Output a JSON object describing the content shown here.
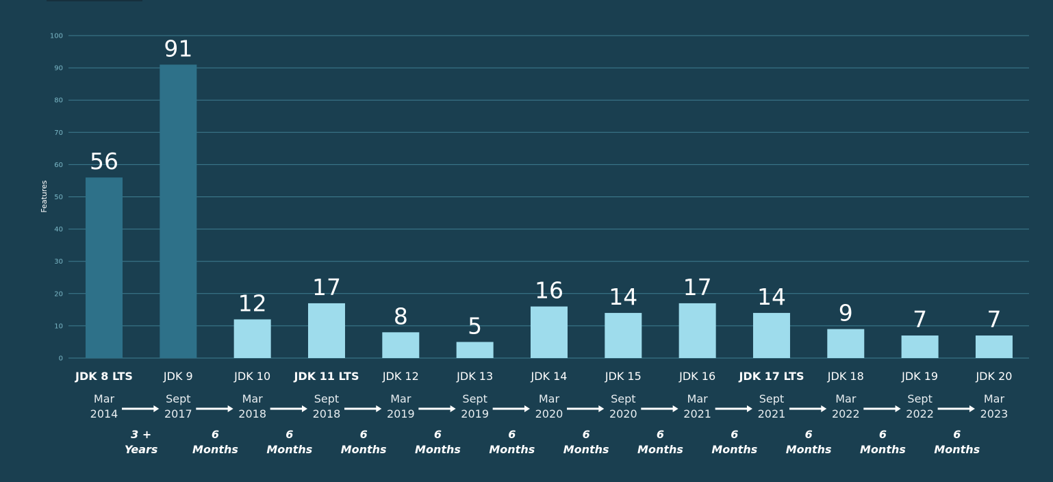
{
  "chart_data": {
    "type": "bar",
    "title": "",
    "xlabel": "",
    "ylabel": "Features",
    "ylim": [
      0,
      100
    ],
    "yticks": [
      0,
      10,
      20,
      30,
      40,
      50,
      60,
      70,
      80,
      90,
      100
    ],
    "grid": true,
    "legend": "none",
    "categories": [
      "JDK 8 LTS",
      "JDK 9",
      "JDK 10",
      "JDK 11 LTS",
      "JDK 12",
      "JDK 13",
      "JDK 14",
      "JDK 15",
      "JDK 16",
      "JDK 17 LTS",
      "JDK 18",
      "JDK 19",
      "JDK 20"
    ],
    "lts": [
      true,
      false,
      false,
      true,
      false,
      false,
      false,
      false,
      false,
      true,
      false,
      false,
      false
    ],
    "values": [
      56,
      91,
      12,
      17,
      8,
      5,
      16,
      14,
      17,
      14,
      9,
      7,
      7
    ],
    "release_dates": [
      {
        "month": "Mar",
        "year": "2014"
      },
      {
        "month": "Sept",
        "year": "2017"
      },
      {
        "month": "Mar",
        "year": "2018"
      },
      {
        "month": "Sept",
        "year": "2018"
      },
      {
        "month": "Mar",
        "year": "2019"
      },
      {
        "month": "Sept",
        "year": "2019"
      },
      {
        "month": "Mar",
        "year": "2020"
      },
      {
        "month": "Sept",
        "year": "2020"
      },
      {
        "month": "Mar",
        "year": "2021"
      },
      {
        "month": "Sept",
        "year": "2021"
      },
      {
        "month": "Mar",
        "year": "2022"
      },
      {
        "month": "Sept",
        "year": "2022"
      },
      {
        "month": "Mar",
        "year": "2023"
      }
    ],
    "intervals": [
      {
        "line1": "3 +",
        "line2": "Years"
      },
      {
        "line1": "6",
        "line2": "Months"
      },
      {
        "line1": "6",
        "line2": "Months"
      },
      {
        "line1": "6",
        "line2": "Months"
      },
      {
        "line1": "6",
        "line2": "Months"
      },
      {
        "line1": "6",
        "line2": "Months"
      },
      {
        "line1": "6",
        "line2": "Months"
      },
      {
        "line1": "6",
        "line2": "Months"
      },
      {
        "line1": "6",
        "line2": "Months"
      },
      {
        "line1": "6",
        "line2": "Months"
      },
      {
        "line1": "6",
        "line2": "Months"
      },
      {
        "line1": "6",
        "line2": "Months"
      }
    ],
    "colors": {
      "background": "#1a3f50",
      "bar_early": "#2e7189",
      "bar_cadence": "#9edcec",
      "grid": "#3f7f92",
      "tick_text": "#7ab7c6",
      "text": "#ffffff"
    },
    "early_bar_count": 2
  }
}
